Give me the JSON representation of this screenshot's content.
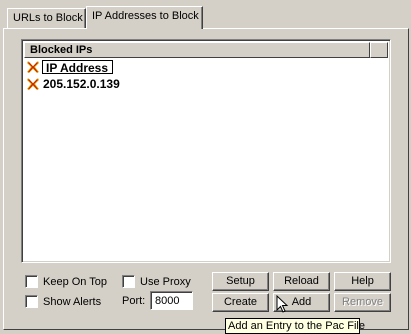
{
  "tabs": [
    {
      "label": "URLs to Block",
      "active": false
    },
    {
      "label": "IP Addresses to Block",
      "active": true
    }
  ],
  "list": {
    "column_header": "Blocked IPs",
    "rows": [
      {
        "icon": "red-x-icon",
        "text": "IP Address",
        "editing": true
      },
      {
        "icon": "red-x-icon",
        "text": "205.152.0.139",
        "editing": false
      }
    ]
  },
  "options": {
    "keep_on_top": {
      "label": "Keep On Top",
      "checked": false
    },
    "show_alerts": {
      "label": "Show Alerts",
      "checked": false
    },
    "use_proxy": {
      "label": "Use Proxy",
      "checked": false
    },
    "port_label": "Port:",
    "port_value": "8000"
  },
  "buttons": {
    "setup": "Setup",
    "reload": "Reload",
    "help": "Help",
    "create": "Create",
    "add": "Add",
    "remove": "Remove"
  },
  "tooltip": "Add an Entry to the Pac File",
  "colors": {
    "icon_red": "#cc2200",
    "icon_yellow": "#e0b000",
    "tooltip_bg": "#ffffe1"
  }
}
